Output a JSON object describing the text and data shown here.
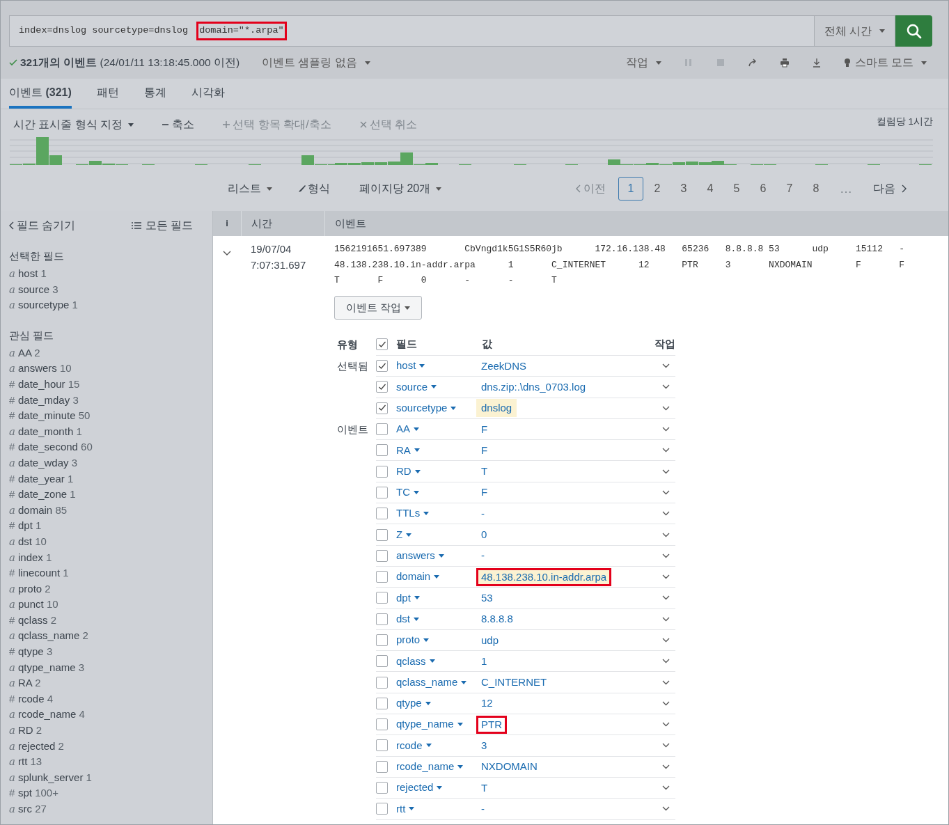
{
  "search": {
    "query": [
      {
        "text": "index=dnslog sourcetype=dnslog ",
        "annotated": false
      },
      {
        "text": "domain=\"*.arpa\"",
        "annotated": true
      }
    ],
    "time_range": "전체 시간"
  },
  "status": {
    "summary": "**321개의 이벤트** (24/01/11 13:18:45.000 이전)",
    "sampling": "이벤트 샘플링 없음"
  },
  "toolbar": [
    {
      "kind": "menu",
      "label": "작업",
      "disabled": false
    },
    {
      "kind": "pause",
      "disabled": true
    },
    {
      "kind": "stop",
      "disabled": true
    },
    {
      "kind": "share",
      "disabled": false
    },
    {
      "kind": "print",
      "disabled": false
    },
    {
      "kind": "download",
      "disabled": false
    },
    {
      "kind": "mode",
      "label": "스마트 모드",
      "disabled": false
    }
  ],
  "tabs": [
    {
      "label": "이벤트 **(321)**",
      "selected": true
    },
    {
      "label": "패턴",
      "selected": false
    },
    {
      "label": "통계",
      "selected": false
    },
    {
      "label": "시각화",
      "selected": false
    }
  ],
  "timeline": {
    "format": "시간 표시줄 형식 지정",
    "actions": [
      {
        "kind": "minus",
        "label": "축소",
        "disabled": false
      },
      {
        "kind": "plus",
        "label": "선택 항목 확대/축소",
        "disabled": true
      },
      {
        "kind": "x",
        "label": "선택 취소",
        "disabled": true
      }
    ],
    "scale": "컬럼당 1시간"
  },
  "results_bar": {
    "view": "리스트",
    "format": "형식",
    "per_page": "페이지당 20개"
  },
  "pagination": {
    "prev": {
      "label": "이전",
      "disabled": true
    },
    "pages": [
      {
        "label": "1",
        "selected": true
      },
      {
        "label": "2",
        "selected": false
      },
      {
        "label": "3",
        "selected": false
      },
      {
        "label": "4",
        "selected": false
      },
      {
        "label": "5",
        "selected": false
      },
      {
        "label": "6",
        "selected": false
      },
      {
        "label": "7",
        "selected": false
      },
      {
        "label": "8",
        "selected": false
      }
    ],
    "ellipsis": "…",
    "next": {
      "label": "다음",
      "disabled": false
    }
  },
  "sidebar": {
    "hide": "필드 숨기기",
    "all": "모든 필드",
    "selected_title": "선택한 필드",
    "selected": [
      {
        "type": "a",
        "name": "host",
        "count": "1"
      },
      {
        "type": "a",
        "name": "source",
        "count": "3"
      },
      {
        "type": "a",
        "name": "sourcetype",
        "count": "1"
      }
    ],
    "interesting_title": "관심 필드",
    "interesting": [
      {
        "type": "a",
        "name": "AA",
        "count": "2"
      },
      {
        "type": "a",
        "name": "answers",
        "count": "10"
      },
      {
        "type": "#",
        "name": "date_hour",
        "count": "15"
      },
      {
        "type": "#",
        "name": "date_mday",
        "count": "3"
      },
      {
        "type": "#",
        "name": "date_minute",
        "count": "50"
      },
      {
        "type": "a",
        "name": "date_month",
        "count": "1"
      },
      {
        "type": "#",
        "name": "date_second",
        "count": "60"
      },
      {
        "type": "a",
        "name": "date_wday",
        "count": "3"
      },
      {
        "type": "#",
        "name": "date_year",
        "count": "1"
      },
      {
        "type": "#",
        "name": "date_zone",
        "count": "1"
      },
      {
        "type": "a",
        "name": "domain",
        "count": "85"
      },
      {
        "type": "#",
        "name": "dpt",
        "count": "1"
      },
      {
        "type": "a",
        "name": "dst",
        "count": "10"
      },
      {
        "type": "a",
        "name": "index",
        "count": "1"
      },
      {
        "type": "#",
        "name": "linecount",
        "count": "1"
      },
      {
        "type": "a",
        "name": "proto",
        "count": "2"
      },
      {
        "type": "a",
        "name": "punct",
        "count": "10"
      },
      {
        "type": "#",
        "name": "qclass",
        "count": "2"
      },
      {
        "type": "a",
        "name": "qclass_name",
        "count": "2"
      },
      {
        "type": "#",
        "name": "qtype",
        "count": "3"
      },
      {
        "type": "a",
        "name": "qtype_name",
        "count": "3"
      },
      {
        "type": "a",
        "name": "RA",
        "count": "2"
      },
      {
        "type": "#",
        "name": "rcode",
        "count": "4"
      },
      {
        "type": "a",
        "name": "rcode_name",
        "count": "4"
      },
      {
        "type": "a",
        "name": "RD",
        "count": "2"
      },
      {
        "type": "a",
        "name": "rejected",
        "count": "2"
      },
      {
        "type": "a",
        "name": "rtt",
        "count": "13"
      },
      {
        "type": "a",
        "name": "splunk_server",
        "count": "1"
      },
      {
        "type": "#",
        "name": "spt",
        "count": "100+"
      },
      {
        "type": "a",
        "name": "src",
        "count": "27"
      }
    ]
  },
  "results": {
    "columns": [
      "i",
      "시간",
      "이벤트"
    ],
    "event": {
      "expanded": true,
      "time": [
        "19/07/04",
        "7:07:31.697"
      ],
      "raw": [
        "1562191651.697389\tCbVngd1k5G1S5R60jb\t172.16.138.48\t65236\t8.8.8.8 53\tudp\t15112\t-",
        "48.138.238.10.in-addr.arpa\t1\tC_INTERNET\t12\tPTR\t3\tNXDOMAIN\tF\tF",
        "T\tF\t0\t-\t-\tT"
      ],
      "actions": "이벤트 작업",
      "fields_header": {
        "type": "유형",
        "all_checked": true,
        "field": "필드",
        "value": "값",
        "action": "작업"
      },
      "fields": [
        {
          "group": "선택됨",
          "name": "host",
          "value": "ZeekDNS",
          "checked": true,
          "highlighted": false,
          "annotated": false
        },
        {
          "name": "source",
          "value": "dns.zip:.\\dns_0703.log",
          "checked": true,
          "highlighted": false,
          "annotated": false
        },
        {
          "name": "sourcetype",
          "value": "dnslog",
          "checked": true,
          "highlighted": true,
          "annotated": false
        },
        {
          "group": "이벤트",
          "name": "AA",
          "value": "F",
          "checked": false,
          "highlighted": false,
          "annotated": false
        },
        {
          "name": "RA",
          "value": "F",
          "checked": false,
          "highlighted": false,
          "annotated": false
        },
        {
          "name": "RD",
          "value": "T",
          "checked": false,
          "highlighted": false,
          "annotated": false
        },
        {
          "name": "TC",
          "value": "F",
          "checked": false,
          "highlighted": false,
          "annotated": false
        },
        {
          "name": "TTLs",
          "value": "-",
          "checked": false,
          "highlighted": false,
          "annotated": false
        },
        {
          "name": "Z",
          "value": "0",
          "checked": false,
          "highlighted": false,
          "annotated": false
        },
        {
          "name": "answers",
          "value": "-",
          "checked": false,
          "highlighted": false,
          "annotated": false
        },
        {
          "name": "domain",
          "value": "48.138.238.10.in-addr.arpa",
          "checked": false,
          "highlighted": true,
          "annotated": true
        },
        {
          "name": "dpt",
          "value": "53",
          "checked": false,
          "highlighted": false,
          "annotated": false
        },
        {
          "name": "dst",
          "value": "8.8.8.8",
          "checked": false,
          "highlighted": false,
          "annotated": false
        },
        {
          "name": "proto",
          "value": "udp",
          "checked": false,
          "highlighted": false,
          "annotated": false
        },
        {
          "name": "qclass",
          "value": "1",
          "checked": false,
          "highlighted": false,
          "annotated": false
        },
        {
          "name": "qclass_name",
          "value": "C_INTERNET",
          "checked": false,
          "highlighted": false,
          "annotated": false
        },
        {
          "name": "qtype",
          "value": "12",
          "checked": false,
          "highlighted": false,
          "annotated": false
        },
        {
          "name": "qtype_name",
          "value": "PTR",
          "checked": false,
          "highlighted": false,
          "annotated": true
        },
        {
          "name": "rcode",
          "value": "3",
          "checked": false,
          "highlighted": false,
          "annotated": false
        },
        {
          "name": "rcode_name",
          "value": "NXDOMAIN",
          "checked": false,
          "highlighted": false,
          "annotated": false
        },
        {
          "name": "rejected",
          "value": "T",
          "checked": false,
          "highlighted": false,
          "annotated": false
        },
        {
          "name": "rtt",
          "value": "-",
          "checked": false,
          "highlighted": false,
          "annotated": false
        }
      ]
    }
  }
}
